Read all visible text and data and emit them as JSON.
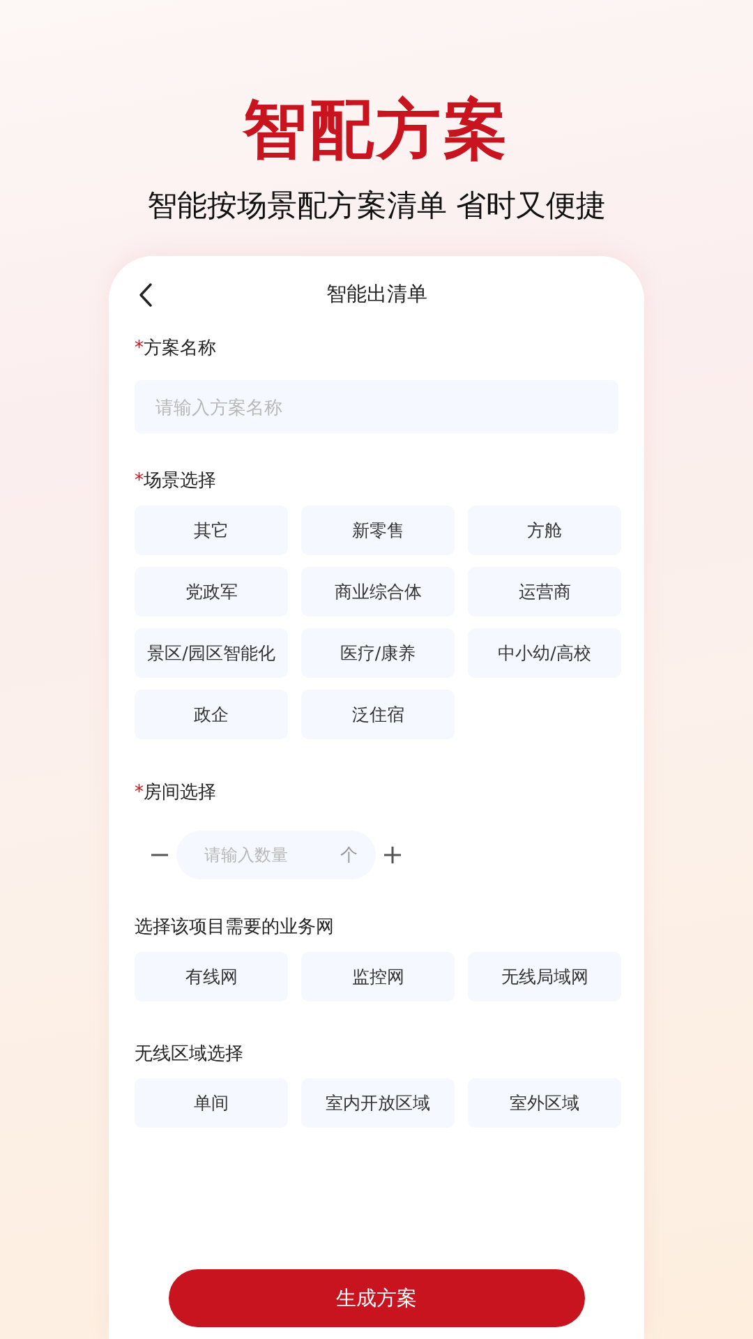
{
  "headline": "智配方案",
  "tagline": "智能按场景配方案清单 省时又便捷",
  "screen": {
    "title": "智能出清单",
    "name_field": {
      "label": {
        "mark": "*",
        "text": "方案名称"
      },
      "placeholder": "请输入方案名称"
    },
    "scenes": {
      "label": {
        "mark": "*",
        "text": "场景选择"
      },
      "options": [
        {
          "label": "其它",
          "selected": false
        },
        {
          "label": "新零售",
          "selected": false
        },
        {
          "label": "方舱",
          "selected": false
        },
        {
          "label": "党政军",
          "selected": false
        },
        {
          "label": "商业综合体",
          "selected": false
        },
        {
          "label": "运营商",
          "selected": false
        },
        {
          "label": "景区/园区智能化",
          "selected": false
        },
        {
          "label": "医疗/康养",
          "selected": false
        },
        {
          "label": "中小幼/高校",
          "selected": false
        },
        {
          "label": "政企",
          "selected": false
        },
        {
          "label": "泛住宿",
          "selected": false
        }
      ]
    },
    "rooms": {
      "label": {
        "mark": "*",
        "text": "房间选择"
      },
      "placeholder": "请输入数量",
      "unit": "个"
    },
    "networks": {
      "label": {
        "text": "选择该项目需要的业务网"
      },
      "options": [
        {
          "label": "有线网",
          "selected": false
        },
        {
          "label": "监控网",
          "selected": false
        },
        {
          "label": "无线局域网",
          "selected": false
        }
      ]
    },
    "wireless_areas": {
      "label": {
        "text": "无线区域选择"
      },
      "options": [
        {
          "label": "单间",
          "selected": false
        },
        {
          "label": "室内开放区域",
          "selected": false
        },
        {
          "label": "室外区域",
          "selected": false
        }
      ]
    },
    "submit": "生成方案"
  }
}
